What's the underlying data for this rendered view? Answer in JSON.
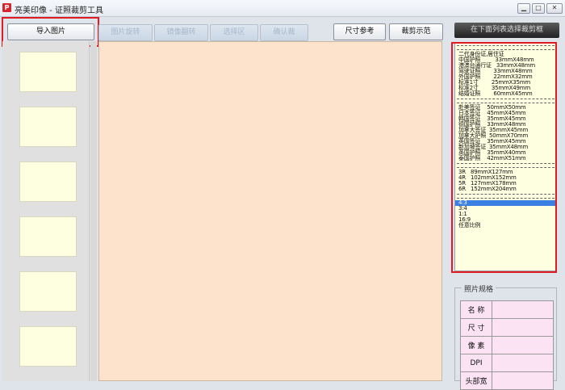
{
  "window": {
    "title": "亮美印像 - 证照裁剪工具",
    "app_icon_label": "P",
    "controls": {
      "minimize": "▁",
      "maximize": "□",
      "close": "✕"
    }
  },
  "toolbar": {
    "import_label": "导入图片",
    "disabled_buttons": [
      "图片旋转",
      "镜像翻转",
      "选择区",
      "确认裁"
    ],
    "size_ref_label": "尺寸参考",
    "crop_demo_label": "裁剪示范"
  },
  "right_panel": {
    "header": "在下面列表选择裁剪框",
    "groups": [
      [
        "二代身份证,居住证",
        "中国护照         33mmX48mm",
        "港澳台通行证   33mmX48mm",
        "驾驶证照        33mmX48mm",
        "外国护照        22mmX32mm",
        "标准1寸        25mmX35mm",
        "标准2寸        35mmX49mm",
        "结婚证照        60mmX45mm"
      ],
      [
        "赴美签证    50mmX50mm",
        "日本签证    45mmX45mm",
        "韩国签证    35mmX45mm",
        "德国护照    33mmX48mm",
        "加拿大签证  35mmX45mm",
        "加拿大护照  50mmX70mm",
        "英国签证    35mmX45mm",
        "新加坡签证  35mmX48mm",
        "英国护照    35mmX40mm",
        "泰国护照    42mmX51mm"
      ],
      [
        "3R   89mmX127mm",
        "4R   102mmX152mm",
        "5R   127mmX178mm",
        "6R   152mmX204mm"
      ],
      [
        "4:3",
        "3:4",
        "1:1",
        "16:9",
        "任意比例"
      ]
    ],
    "selected_item": "4:3"
  },
  "spec": {
    "title": "照片规格",
    "rows": [
      {
        "key": "名 称",
        "value": ""
      },
      {
        "key": "尺 寸",
        "value": ""
      },
      {
        "key": "像 素",
        "value": ""
      },
      {
        "key": "DPI",
        "value": ""
      },
      {
        "key": "头部宽",
        "value": ""
      }
    ]
  },
  "colors": {
    "canvas_bg": "#fde3cb",
    "list_bg": "#fefee0",
    "highlight": "#e01b24",
    "selected": "#3b7fe3"
  }
}
